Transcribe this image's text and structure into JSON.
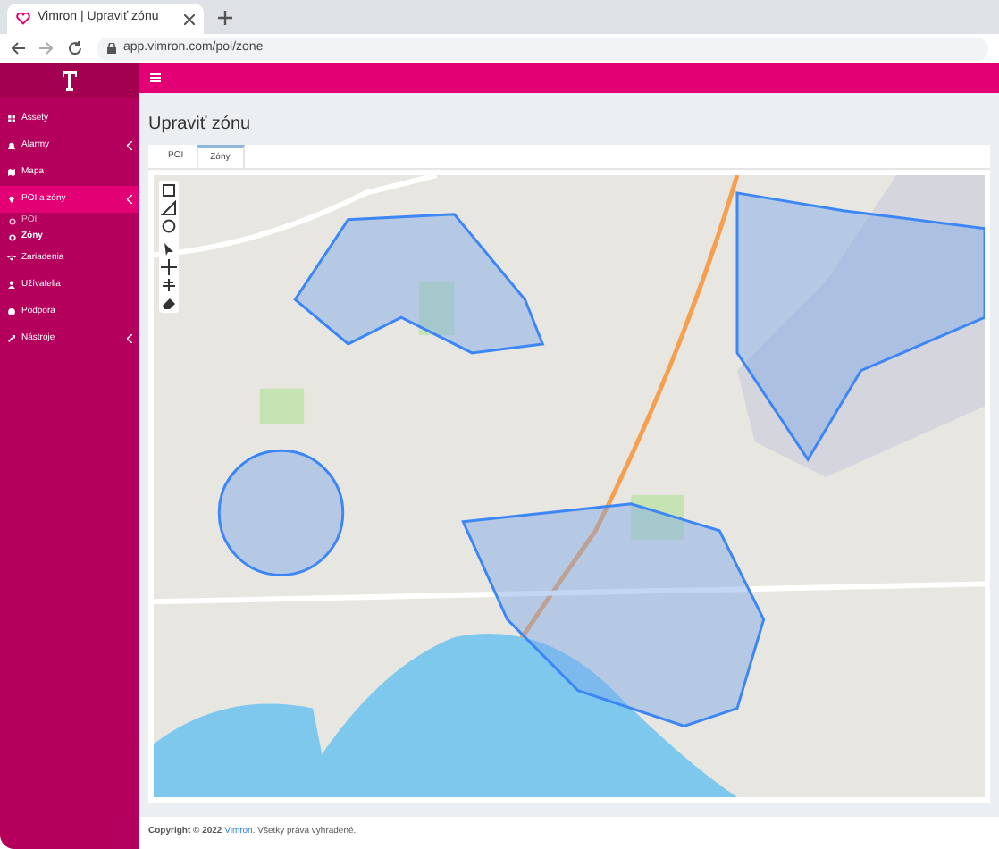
{
  "browser": {
    "tab_title": "Vimron | Upraviť zónu",
    "url": "app.vimron.com/poi/zone"
  },
  "sidebar": {
    "items": [
      {
        "label": "Assety",
        "selected": false,
        "expandable": false
      },
      {
        "label": "Alarmy",
        "selected": false,
        "expandable": true
      },
      {
        "label": "Mapa",
        "selected": false,
        "expandable": false
      },
      {
        "label": "POI a zóny",
        "selected": true,
        "expandable": true,
        "children": [
          {
            "label": "POI",
            "selected": false
          },
          {
            "label": "Zóny",
            "selected": true
          }
        ]
      },
      {
        "label": "Zariadenia",
        "selected": false,
        "expandable": false
      },
      {
        "label": "Užívatelia",
        "selected": false,
        "expandable": false
      },
      {
        "label": "Podpora",
        "selected": false,
        "expandable": false
      },
      {
        "label": "Nástroje",
        "selected": false,
        "expandable": true
      }
    ]
  },
  "page": {
    "title": "Upraviť zónu",
    "tabs": [
      {
        "label": "POI",
        "selected": false
      },
      {
        "label": "Zóny",
        "selected": true
      }
    ]
  },
  "footer": {
    "copyright": "Copyright © 2022",
    "link": "Vimron",
    "rest": ". Všetky práva vyhradené."
  }
}
